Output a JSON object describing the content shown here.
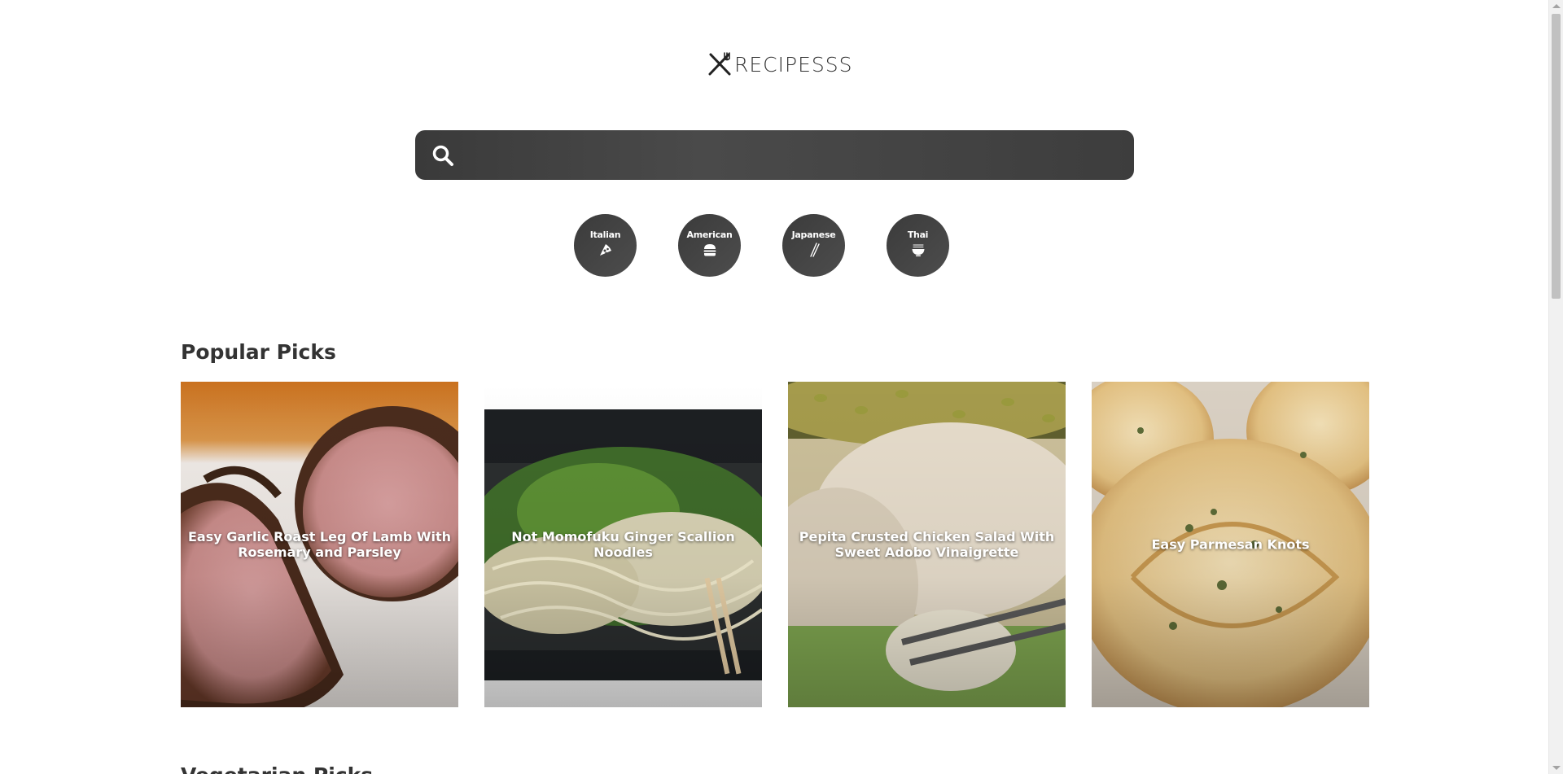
{
  "logo": {
    "text": "RECIPESSS"
  },
  "search": {
    "value": "",
    "placeholder": ""
  },
  "cuisines": [
    {
      "label": "Italian",
      "icon": "pizza-icon"
    },
    {
      "label": "American",
      "icon": "burger-icon"
    },
    {
      "label": "Japanese",
      "icon": "chopsticks-icon"
    },
    {
      "label": "Thai",
      "icon": "noodle-bowl-icon"
    }
  ],
  "sections": {
    "popular": {
      "title": "Popular Picks",
      "cards": [
        {
          "title": "Easy Garlic Roast Leg Of Lamb With Rosemary and Parsley"
        },
        {
          "title": "Not Momofuku Ginger Scallion Noodles"
        },
        {
          "title": "Pepita Crusted Chicken Salad With Sweet Adobo Vinaigrette"
        },
        {
          "title": "Easy Parmesan Knots"
        }
      ]
    },
    "vegetarian": {
      "title": "Vegetarian Picks"
    }
  },
  "colors": {
    "accent_dark": "#3a3a3a",
    "text": "#333333",
    "background": "#ffffff"
  }
}
